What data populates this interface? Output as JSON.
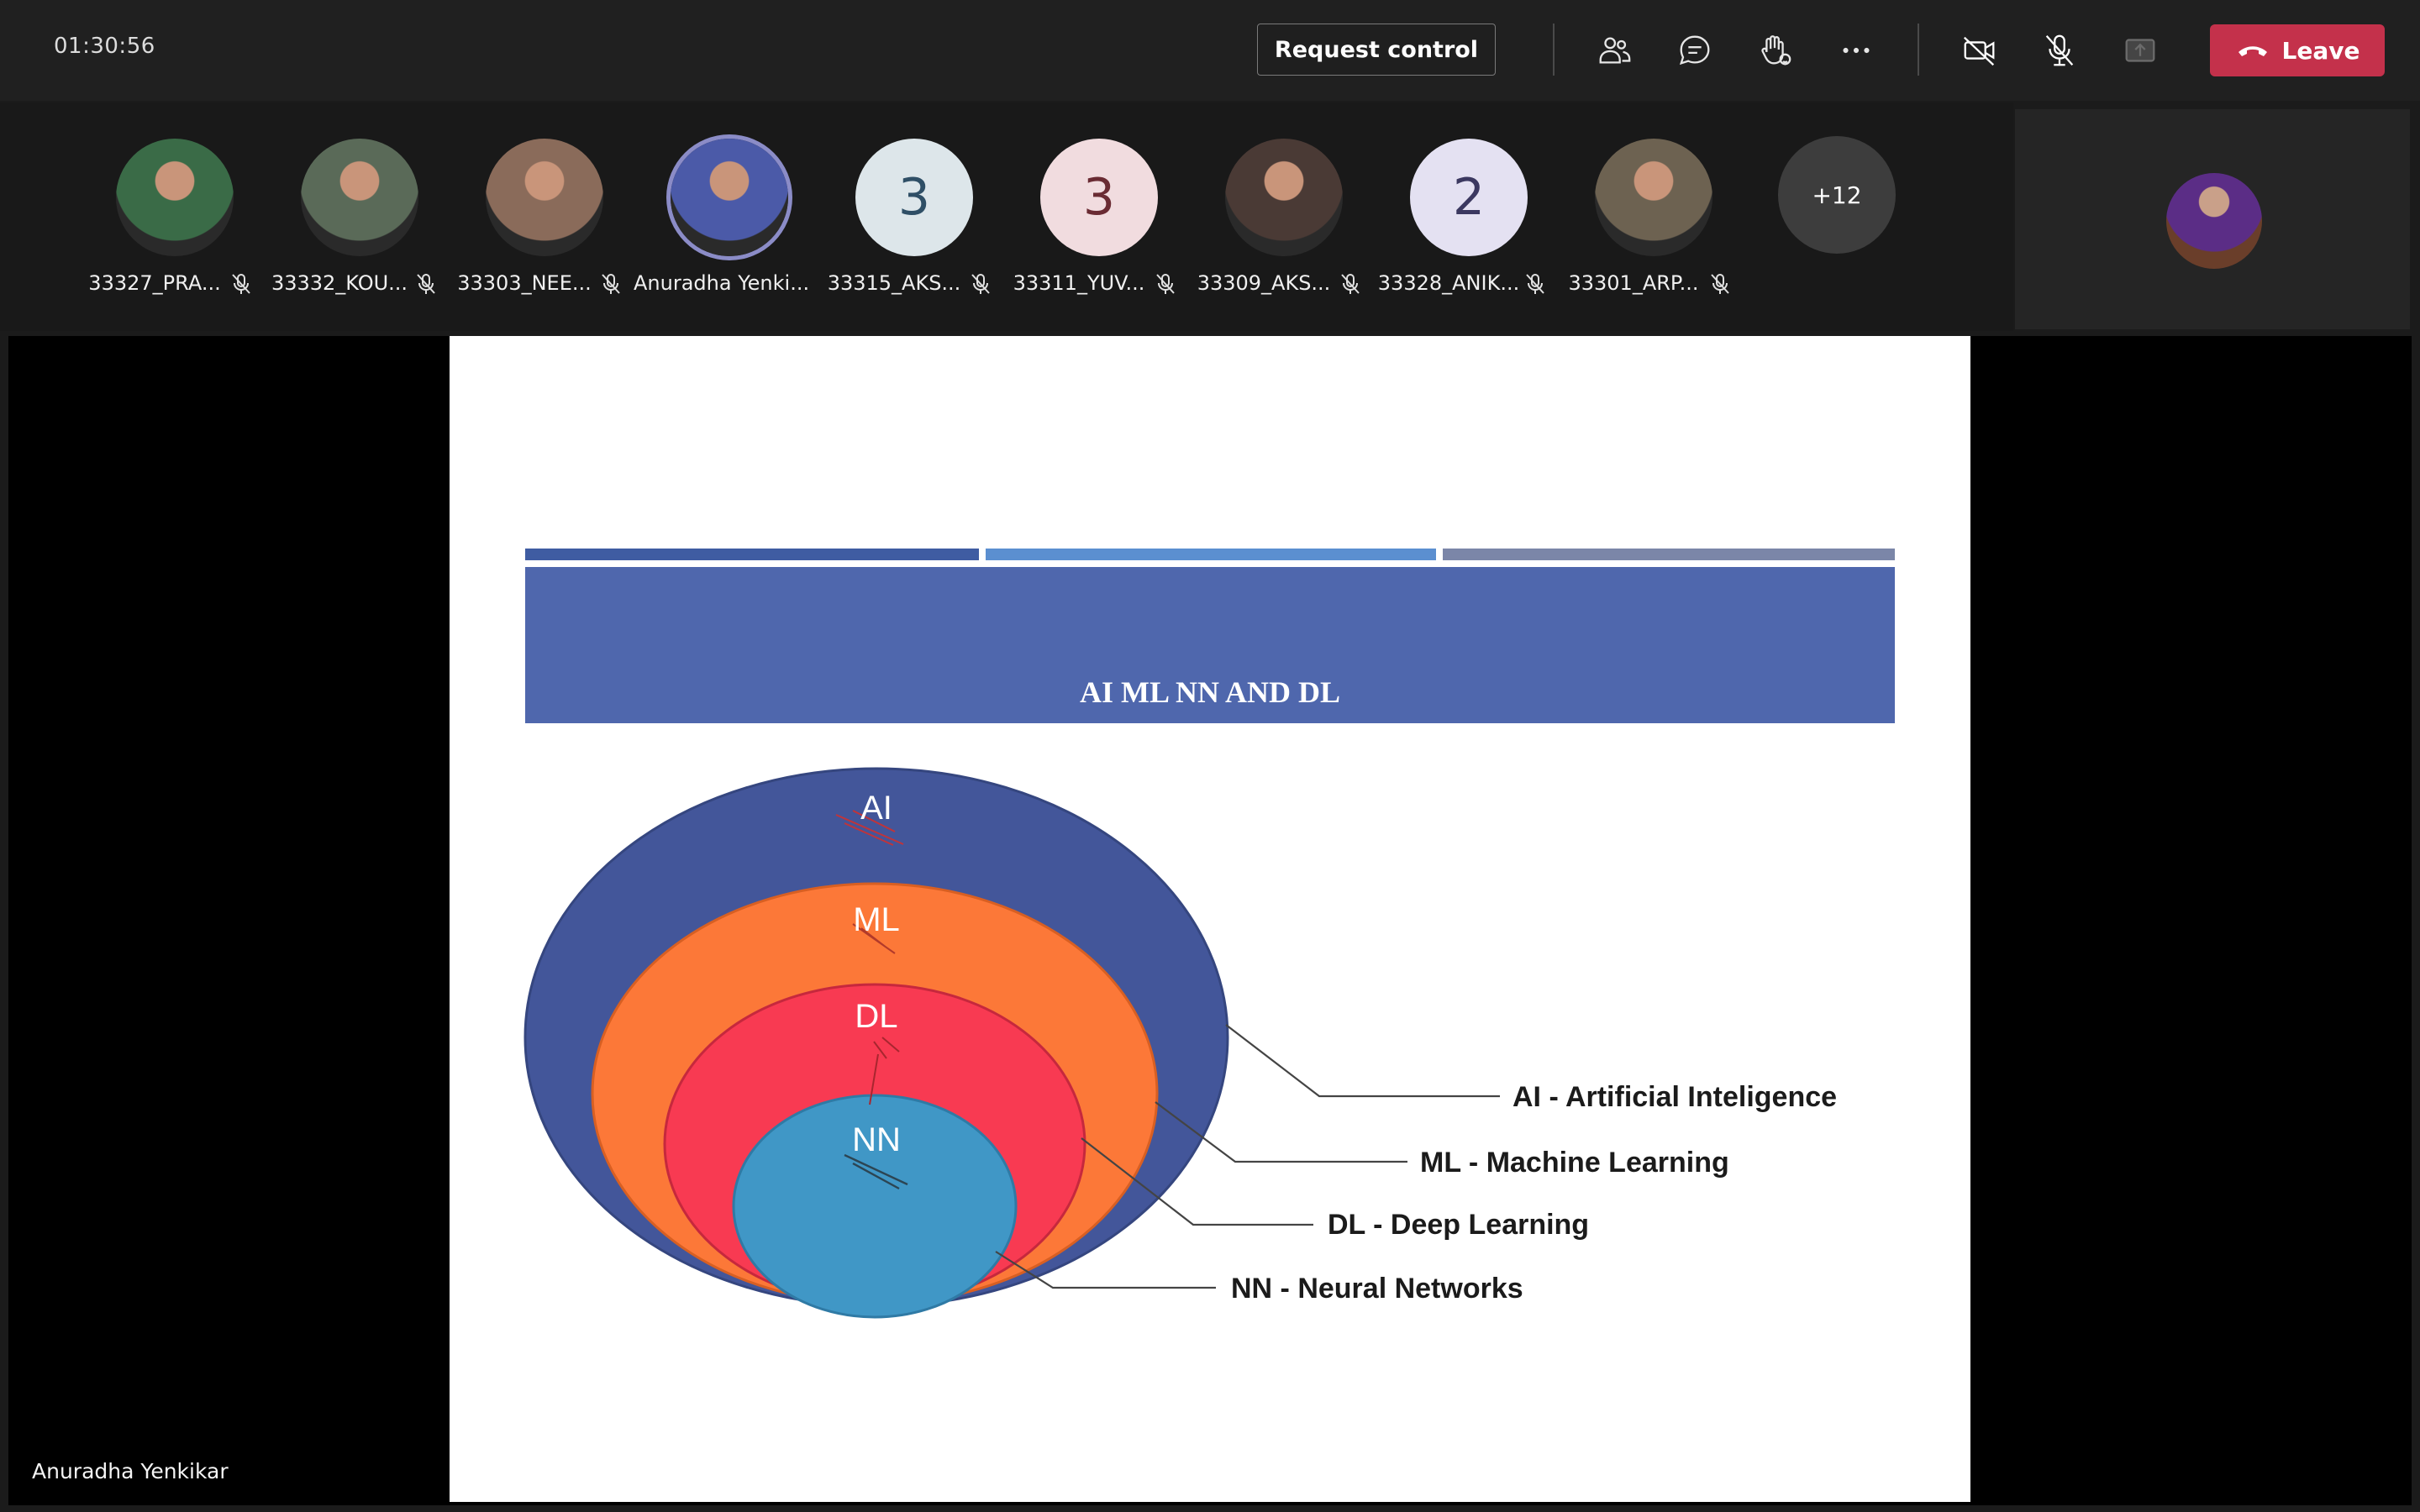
{
  "meeting": {
    "timer": "01:30:56",
    "request_control_label": "Request control",
    "leave_label": "Leave",
    "icons": [
      "people-icon",
      "chat-icon",
      "raise-hand-icon",
      "more-options-icon",
      "camera-off-icon",
      "mic-off-icon",
      "share-tray-icon"
    ]
  },
  "participants": [
    {
      "name": "33327_PRA...",
      "avatar": "photo",
      "bg": "#3a6b47"
    },
    {
      "name": "33332_KOU...",
      "avatar": "photo",
      "bg": "#5a6a58"
    },
    {
      "name": "33303_NEE...",
      "avatar": "photo",
      "bg": "#8a6b5a"
    },
    {
      "name": "Anuradha Yenki...",
      "avatar": "photo",
      "bg": "#4b5aa8",
      "active": true
    },
    {
      "name": "33315_AKS...",
      "avatar": "3",
      "bg": "#dde6ea",
      "fg": "#2f4f66"
    },
    {
      "name": "33311_YUV...",
      "avatar": "3",
      "bg": "#f1dcdf",
      "fg": "#6a2b33"
    },
    {
      "name": "33309_AKS...",
      "avatar": "photo",
      "bg": "#4a3a35"
    },
    {
      "name": "33328_ANIK...",
      "avatar": "2",
      "bg": "#e4e1f2",
      "fg": "#3b3860"
    },
    {
      "name": "33301_ARP...",
      "avatar": "photo",
      "bg": "#6d6251"
    }
  ],
  "overflow_count": "+12",
  "presenter": {
    "name": "Anuradha Yenkikar"
  },
  "slide": {
    "title": "AI ML NN AND DL",
    "colors": {
      "title_band": "#4f67ad",
      "ai": "#43569a",
      "ml": "#fc7838",
      "dl": "#f83a52",
      "nn": "#4097c6"
    },
    "rings": [
      "AI",
      "ML",
      "DL",
      "NN"
    ],
    "legend": [
      "AI - Artificial Inteligence",
      "ML - Machine Learning",
      "DL - Deep Learning",
      "NN - Neural Networks"
    ]
  }
}
